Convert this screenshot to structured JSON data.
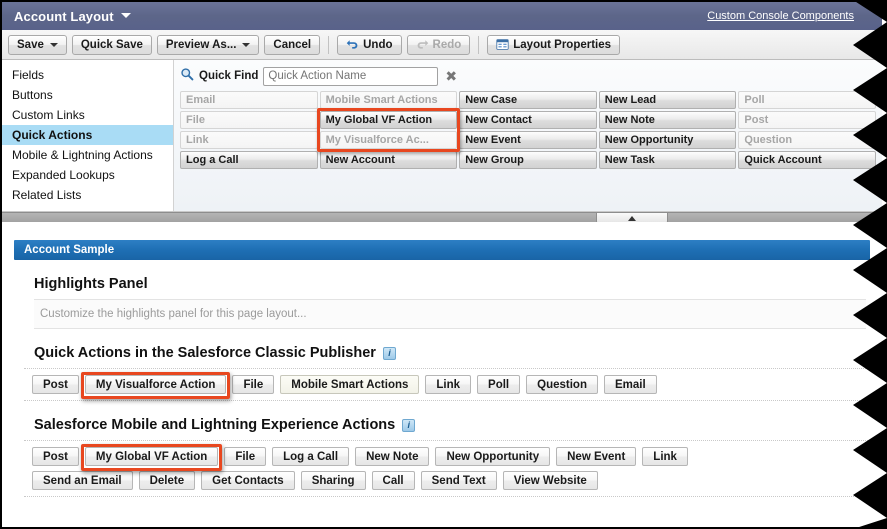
{
  "window": {
    "title": "Account Layout",
    "title_caret_icon": "caret-down-icon",
    "console_link": "Custom Console Components"
  },
  "toolbar": {
    "save_label": "Save",
    "save_caret_icon": "caret-down-icon",
    "quick_save_label": "Quick Save",
    "preview_as_label": "Preview As...",
    "preview_caret_icon": "caret-down-icon",
    "cancel_label": "Cancel",
    "undo_label": "Undo",
    "undo_icon": "undo-arrow-icon",
    "redo_label": "Redo",
    "redo_icon": "redo-arrow-icon",
    "redo_disabled": true,
    "layout_properties_label": "Layout Properties",
    "layout_properties_icon": "grid-properties-icon"
  },
  "sidebar": {
    "items": [
      {
        "label": "Fields",
        "selected": false
      },
      {
        "label": "Buttons",
        "selected": false
      },
      {
        "label": "Custom Links",
        "selected": false
      },
      {
        "label": "Quick Actions",
        "selected": true
      },
      {
        "label": "Mobile & Lightning Actions",
        "selected": false
      },
      {
        "label": "Expanded Lookups",
        "selected": false
      },
      {
        "label": "Related Lists",
        "selected": false
      }
    ]
  },
  "palette": {
    "quick_find_label": "Quick Find",
    "quick_find_icon": "magnifier-icon",
    "quick_find_value": "",
    "quick_find_placeholder": "Quick Action Name",
    "clear_icon": "clear-x-icon",
    "collapse_icon": "triangle-up-icon",
    "actions": [
      {
        "label": "Email",
        "used": true
      },
      {
        "label": "Mobile Smart Actions",
        "used": true
      },
      {
        "label": "New Case",
        "used": false
      },
      {
        "label": "New Lead",
        "used": false
      },
      {
        "label": "Poll",
        "used": true
      },
      {
        "label": "File",
        "used": true
      },
      {
        "label": "My Global VF Action",
        "used": false,
        "highlighted": true
      },
      {
        "label": "New Contact",
        "used": false
      },
      {
        "label": "New Note",
        "used": false
      },
      {
        "label": "Post",
        "used": true
      },
      {
        "label": "Link",
        "used": true
      },
      {
        "label": "My Visualforce Ac...",
        "used": true,
        "highlighted": true
      },
      {
        "label": "New Event",
        "used": false
      },
      {
        "label": "New Opportunity",
        "used": false
      },
      {
        "label": "Question",
        "used": true
      },
      {
        "label": "Log a Call",
        "used": false
      },
      {
        "label": "New Account",
        "used": false
      },
      {
        "label": "New Group",
        "used": false
      },
      {
        "label": "New Task",
        "used": false
      },
      {
        "label": "Quick Account",
        "used": false
      }
    ]
  },
  "preview": {
    "sample_bar_label": "Account Sample",
    "highlights": {
      "title": "Highlights Panel",
      "placeholder": "Customize the highlights panel for this page layout..."
    },
    "classic_publisher": {
      "title": "Quick Actions in the Salesforce Classic Publisher",
      "info_icon": "info-icon",
      "info_glyph": "i",
      "buttons": [
        {
          "label": "Post"
        },
        {
          "label": "My Visualforce Action",
          "highlighted": true
        },
        {
          "label": "File"
        },
        {
          "label": "Mobile Smart Actions",
          "style": "msa"
        },
        {
          "label": "Link"
        },
        {
          "label": "Poll"
        },
        {
          "label": "Question"
        },
        {
          "label": "Email"
        }
      ]
    },
    "mobile_lightning": {
      "title": "Salesforce Mobile and Lightning Experience Actions",
      "info_icon": "info-icon",
      "info_glyph": "i",
      "rows": [
        [
          {
            "label": "Post"
          },
          {
            "label": "My Global VF Action",
            "highlighted": true
          },
          {
            "label": "File"
          },
          {
            "label": "Log a Call"
          },
          {
            "label": "New Note"
          },
          {
            "label": "New Opportunity"
          },
          {
            "label": "New Event"
          },
          {
            "label": "Link"
          }
        ],
        [
          {
            "label": "Send an Email"
          },
          {
            "label": "Delete"
          },
          {
            "label": "Get Contacts"
          },
          {
            "label": "Sharing"
          },
          {
            "label": "Call"
          },
          {
            "label": "Send Text"
          },
          {
            "label": "View Website"
          }
        ]
      ]
    }
  },
  "colors": {
    "titlebar": "#5d6689",
    "sample_bar": "#1e6fb4",
    "selected_item": "#a9dcf5",
    "highlight_outline": "#e8471f",
    "used_action_text": "#a6a6a6"
  }
}
